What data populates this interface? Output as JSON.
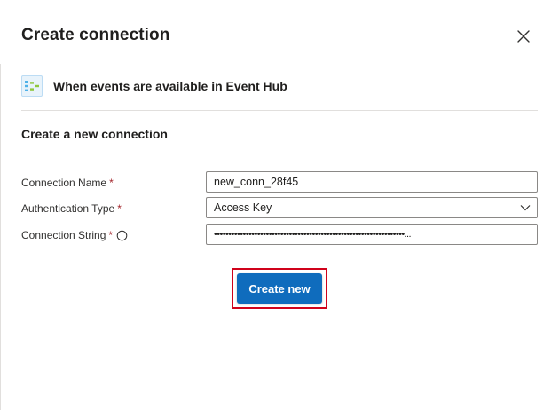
{
  "dialog": {
    "title": "Create connection",
    "close_icon": "close-icon"
  },
  "trigger": {
    "icon": "event-hub-icon",
    "label": "When events are available in Event Hub"
  },
  "section": {
    "title": "Create a new connection"
  },
  "form": {
    "connection_name": {
      "label": "Connection Name",
      "required_mark": "*",
      "value": "new_conn_28f45"
    },
    "auth_type": {
      "label": "Authentication Type",
      "required_mark": "*",
      "value": "Access Key",
      "icon": "chevron-down-icon"
    },
    "connection_string": {
      "label": "Connection String",
      "required_mark": "*",
      "info_icon": "info-icon",
      "masked_value": "••••••••••••••••••••••••••••••••••••••••••••••••••••••••••••••••••..."
    }
  },
  "actions": {
    "create_label": "Create new"
  },
  "colors": {
    "primary": "#0f6cbd",
    "required": "#a4262c",
    "highlight": "#d0021b"
  }
}
